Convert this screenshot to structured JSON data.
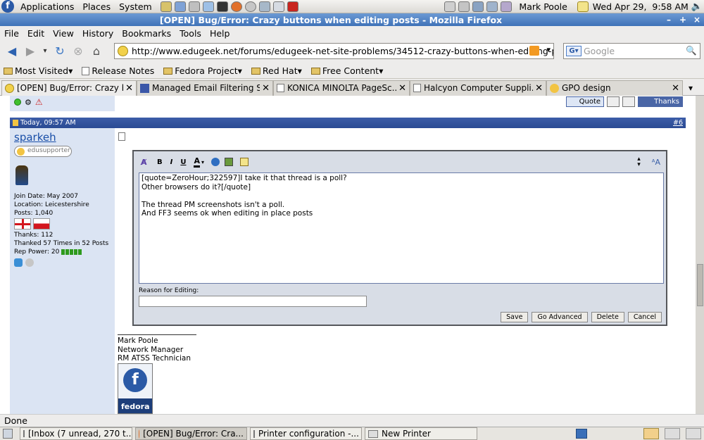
{
  "panel": {
    "menus": [
      "Applications",
      "Places",
      "System"
    ],
    "user": "Mark Poole",
    "clock": "Wed Apr 29,  9:58 AM"
  },
  "window": {
    "title": "[OPEN] Bug/Error: Crazy buttons when editing posts - Mozilla Firefox"
  },
  "menubar": [
    "File",
    "Edit",
    "View",
    "History",
    "Bookmarks",
    "Tools",
    "Help"
  ],
  "nav": {
    "url": "http://www.edugeek.net/forums/edugeek-net-site-problems/34512-crazy-buttons-when-editing-posts",
    "search_placeholder": "Google"
  },
  "bookmarks": [
    {
      "label": "Most Visited",
      "folder": true
    },
    {
      "label": "Release Notes",
      "folder": false
    },
    {
      "label": "Fedora Project",
      "folder": true
    },
    {
      "label": "Red Hat",
      "folder": true
    },
    {
      "label": "Free Content",
      "folder": true
    }
  ],
  "tabs": [
    {
      "label": "[OPEN] Bug/Error: Crazy b...",
      "active": true
    },
    {
      "label": "Managed Email Filtering S...",
      "active": false
    },
    {
      "label": "KONICA MINOLTA PageSc...",
      "active": false
    },
    {
      "label": "Halcyon Computer Suppli...",
      "active": false
    },
    {
      "label": "GPO design",
      "active": false
    }
  ],
  "post_top_buttons": [
    "Quote",
    "Thanks"
  ],
  "post": {
    "timestamp": "Today, 09:57 AM",
    "number": "#6",
    "username": "sparkeh",
    "badge": "edusupporter",
    "join_date": "Join Date: May 2007",
    "location": "Location: Leicestershire",
    "posts": "Posts: 1,040",
    "thanks": "Thanks: 112",
    "thanked": "Thanked 57 Times in 52 Posts",
    "rep_power": "Rep Power: 20"
  },
  "editor": {
    "lines": [
      "[quote=ZeroHour;322597]I take it that thread is a poll?",
      "Other browsers do it?[/quote]",
      "",
      "The thread PM screenshots isn't a poll.",
      "And FF3 seems ok when editing in place posts"
    ],
    "reason_label": "Reason for Editing:",
    "reason_value": "",
    "buttons": {
      "save": "Save",
      "advanced": "Go Advanced",
      "delete": "Delete",
      "cancel": "Cancel"
    }
  },
  "signature": [
    "Mark Poole",
    "Network Manager",
    "RM ATSS Technician"
  ],
  "fedora_badge": "fedora",
  "status": "Done",
  "taskbar": [
    {
      "label": "[Inbox (7 unread, 270 t...",
      "active": false
    },
    {
      "label": "[OPEN] Bug/Error: Cra...",
      "active": true
    },
    {
      "label": "Printer configuration -...",
      "active": false
    },
    {
      "label": "New Printer",
      "active": false
    }
  ]
}
